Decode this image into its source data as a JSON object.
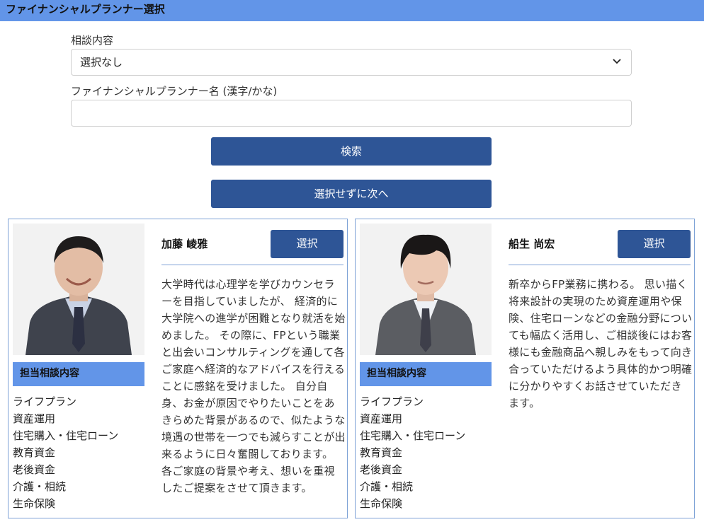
{
  "header": {
    "title": "ファイナンシャルプランナー選択"
  },
  "search": {
    "topic_label": "相談内容",
    "topic_selected": "選択なし",
    "name_label": "ファイナンシャルプランナー名 (漢字/かな)",
    "name_value": "",
    "search_button": "検索",
    "skip_button": "選択せずに次へ"
  },
  "colors": {
    "header_bg": "#6295e8",
    "button_bg": "#2e5596",
    "card_border": "#7ea2d6"
  },
  "planners": [
    {
      "name": "加藤 崚雅",
      "select_label": "選択",
      "topics_title": "担当相談内容",
      "topics": [
        "ライフプラン",
        "資産運用",
        "住宅購入・住宅ローン",
        "教育資金",
        "老後資金",
        "介護・相続",
        "生命保険"
      ],
      "bio": "大学時代は心理学を学びカウンセラーを目指していましたが、 経済的に大学院への進学が困難となり就活を始めました。 その際に、FPという職業と出会いコンサルティングを通して各ご家庭へ経済的なアドバイスを行えることに感銘を受けました。 自分自身、お金が原因でやりたいことをあきらめた背景があるので、似たような境遇の世帯を一つでも減らすことが出来るように日々奮闘しております。 各ご家庭の背景や考え、想いを重視したご提案をさせて頂きます。"
    },
    {
      "name": "船生 尚宏",
      "select_label": "選択",
      "topics_title": "担当相談内容",
      "topics": [
        "ライフプラン",
        "資産運用",
        "住宅購入・住宅ローン",
        "教育資金",
        "老後資金",
        "介護・相続",
        "生命保険"
      ],
      "bio": "新卒からFP業務に携わる。 思い描く将来設計の実現のため資産運用や保険、住宅ローンなどの金融分野についても幅広く活用し、ご相談後にはお客様にも金融商品へ親しみをもって向き合っていただけるよう具体的かつ明確に分かりやすくお話させていただきます。"
    }
  ]
}
